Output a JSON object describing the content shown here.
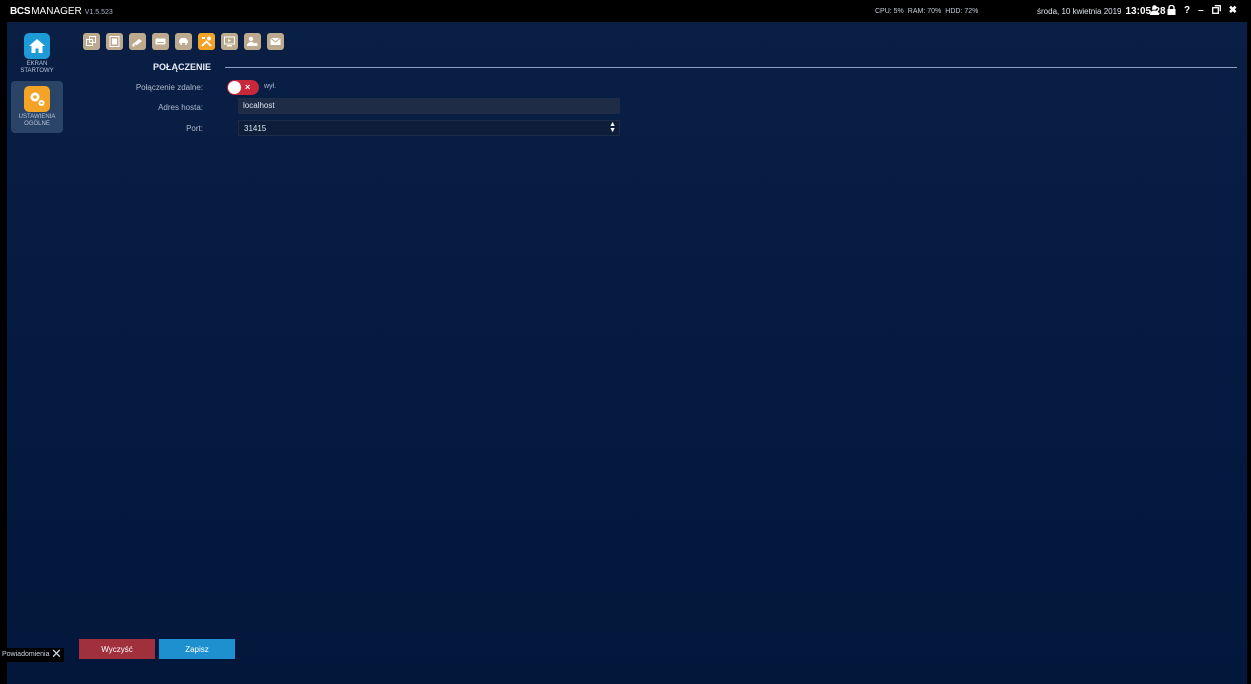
{
  "app": {
    "brand_bold": "BCS",
    "brand_rest": "MANAGER",
    "version": "V1.5.523"
  },
  "stats": {
    "cpu": "CPU: 5%",
    "ram": "RAM: 70%",
    "hdd": "HDD: 72%"
  },
  "datetime": {
    "date": "środa, 10 kwietnia 2019",
    "time": "13:05:28"
  },
  "sidebar": {
    "items": [
      {
        "label": "EKRAN STARTOWY",
        "icon": "home-icon",
        "color": "#1e9bd7"
      },
      {
        "label": "USTAWIENIA OGÓLNE",
        "icon": "gears-icon",
        "color": "#f4a326"
      }
    ]
  },
  "toolbar": {
    "icons": [
      "windows-icon",
      "film-icon",
      "camera-icon",
      "keyboard-icon",
      "car-icon",
      "tools-icon",
      "monitor-icon",
      "user-settings-icon",
      "mail-icon"
    ],
    "active_color": "#f4a326",
    "inactive_color": "#bda98d"
  },
  "form": {
    "section_title": "POŁĄCZENIE",
    "remote_label": "Połączenie zdalne:",
    "remote_state": "wył.",
    "host_label": "Adres hosta:",
    "host_value": "localhost",
    "port_label": "Port:",
    "port_value": "31415"
  },
  "footer": {
    "notifications": "Powiadomienia",
    "clear_label": "Wyczyść",
    "save_label": "Zapisz",
    "clear_color": "#a0303c",
    "save_color": "#1e90d0"
  }
}
